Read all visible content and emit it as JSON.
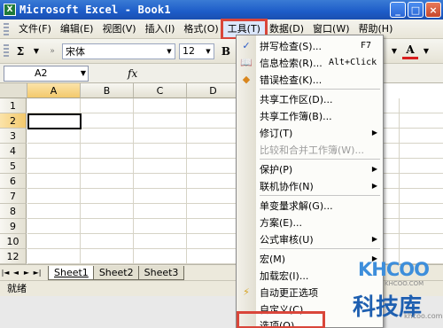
{
  "window": {
    "title": "Microsoft Excel - Book1",
    "app_icon": "X"
  },
  "window_buttons": {
    "minimize": "_",
    "maximize": "□",
    "close": "×"
  },
  "menubar": {
    "items": [
      "文件(F)",
      "编辑(E)",
      "视图(V)",
      "插入(I)",
      "格式(O)",
      "工具(T)",
      "数据(D)",
      "窗口(W)",
      "帮助(H)"
    ],
    "active": "工具(T)"
  },
  "toolbar": {
    "sum_symbol": "Σ",
    "font_name": "宋体",
    "font_size": "12",
    "bold": "B",
    "italic": "I",
    "font_color": "A"
  },
  "formula_bar": {
    "cell_ref": "A2",
    "fx": "fx"
  },
  "grid": {
    "columns": [
      "A",
      "B",
      "C",
      "D"
    ],
    "rows": [
      "1",
      "2",
      "3",
      "4",
      "5",
      "6",
      "7",
      "8",
      "9",
      "10",
      "11",
      "12"
    ],
    "active_cell": "A2"
  },
  "sheets": {
    "tabs": [
      "Sheet1",
      "Sheet2",
      "Sheet3"
    ],
    "active": "Sheet1",
    "nav": [
      "|◄",
      "◄",
      "►",
      "►|"
    ]
  },
  "status": {
    "text": "就绪"
  },
  "tools_menu": {
    "items": [
      {
        "label": "拼写检查(S)...",
        "shortcut": "F7",
        "icon": "spellcheck-icon"
      },
      {
        "label": "信息检索(R)...",
        "shortcut": "Alt+Click",
        "icon": "research-icon"
      },
      {
        "label": "错误检查(K)...",
        "shortcut": "",
        "icon": "error-check-icon"
      },
      {
        "label": "共享工作区(D)...",
        "shortcut": ""
      },
      {
        "label": "共享工作簿(B)...",
        "shortcut": ""
      },
      {
        "label": "修订(T)",
        "submenu": true
      },
      {
        "label": "比较和合并工作簿(W)...",
        "disabled": true
      },
      {
        "label": "保护(P)",
        "submenu": true
      },
      {
        "label": "联机协作(N)",
        "submenu": true
      },
      {
        "label": "单变量求解(G)...",
        "shortcut": ""
      },
      {
        "label": "方案(E)...",
        "shortcut": ""
      },
      {
        "label": "公式审核(U)",
        "submenu": true
      },
      {
        "label": "宏(M)",
        "submenu": true
      },
      {
        "label": "加载宏(I)...",
        "shortcut": ""
      },
      {
        "label": "自动更正选项",
        "icon": "autocorrect-icon"
      },
      {
        "label": "自定义(C)...",
        "shortcut": ""
      },
      {
        "label": "选项(O)...",
        "shortcut": ""
      }
    ]
  },
  "watermark": {
    "logo": "KHCOO",
    "sub": "KHCOO.COM",
    "cn": "科技库",
    "url": "khcoo.com"
  }
}
